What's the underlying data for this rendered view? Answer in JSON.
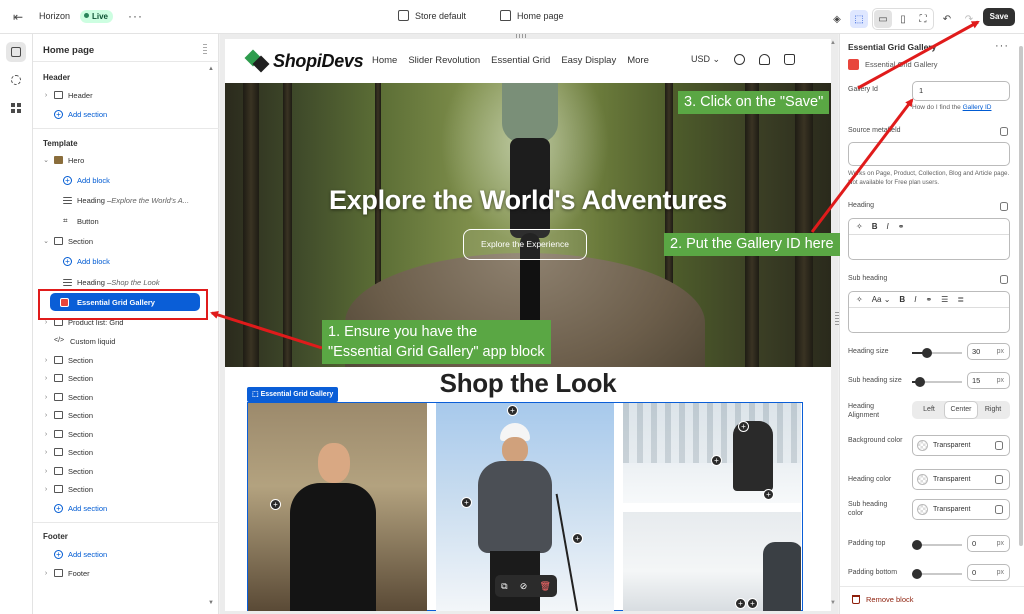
{
  "topbar": {
    "theme_name": "Horizon",
    "live_badge": "Live",
    "store_label": "Store default",
    "page_label": "Home page",
    "save_label": "Save"
  },
  "sidebar": {
    "title": "Home page",
    "header_group": "Header",
    "header_item": "Header",
    "add_section": "Add section",
    "template_group": "Template",
    "hero": "Hero",
    "add_block": "Add block",
    "hero_heading_prefix": "Heading – ",
    "hero_heading_text": "Explore the World's A...",
    "button": "Button",
    "section": "Section",
    "section_heading_prefix": "Heading – ",
    "section_heading_text": "Shop the Look",
    "egg_block": "Essential Grid Gallery",
    "product_list": "Product list: Grid",
    "custom_liquid": "Custom liquid",
    "sections": [
      "Section",
      "Section",
      "Section",
      "Section",
      "Section",
      "Section",
      "Section",
      "Section"
    ],
    "footer_group": "Footer",
    "footer_item": "Footer"
  },
  "store": {
    "logo": "ShopiDevs",
    "nav": [
      "Home",
      "Slider Revolution",
      "Essential Grid",
      "Easy Display",
      "More"
    ],
    "currency": "USD",
    "hero_title": "Explore the World's Adventures",
    "hero_button": "Explore the Experience",
    "shop_title": "Shop the Look",
    "egg_tag": "Essential Grid Gallery"
  },
  "panel": {
    "title": "Essential Grid Gallery",
    "subtitle": "Essential Grid Gallery",
    "gallery_id_label": "Gallery Id",
    "gallery_id_value": "1",
    "gallery_help_prefix": "How do I find the ",
    "gallery_help_link": "Gallery ID",
    "source_label": "Source metafield",
    "source_note": "Works on Page, Product, Collection, Blog and Article page. Not available for Free plan users.",
    "heading_label": "Heading",
    "subheading_label": "Sub heading",
    "heading_size_label": "Heading size",
    "heading_size": "30",
    "subheading_size_label": "Sub heading size",
    "subheading_size": "15",
    "unit": "px",
    "alignment_label": "Heading Alignment",
    "alignment_options": [
      "Left",
      "Center",
      "Right"
    ],
    "bg_color_label": "Background color",
    "heading_color_label": "Heading color",
    "subheading_color_label": "Sub heading color",
    "transparent": "Transparent",
    "padding_top_label": "Padding top",
    "padding_top": "0",
    "padding_bottom_label": "Padding bottom",
    "padding_bottom": "0",
    "remove_block": "Remove block",
    "heading_size_level": 0.3,
    "subheading_size_level": 0.15
  },
  "callouts": {
    "step1_line1": "1. Ensure you have the",
    "step1_line2": "\"Essential Grid Gallery\" app block",
    "step2": "2. Put the Gallery ID here",
    "step3": "3. Click on the \"Save\""
  },
  "colors": {
    "accent_blue": "#0a5ed7",
    "callout_green": "#5aa744",
    "arrow_red": "#e01b1b"
  }
}
